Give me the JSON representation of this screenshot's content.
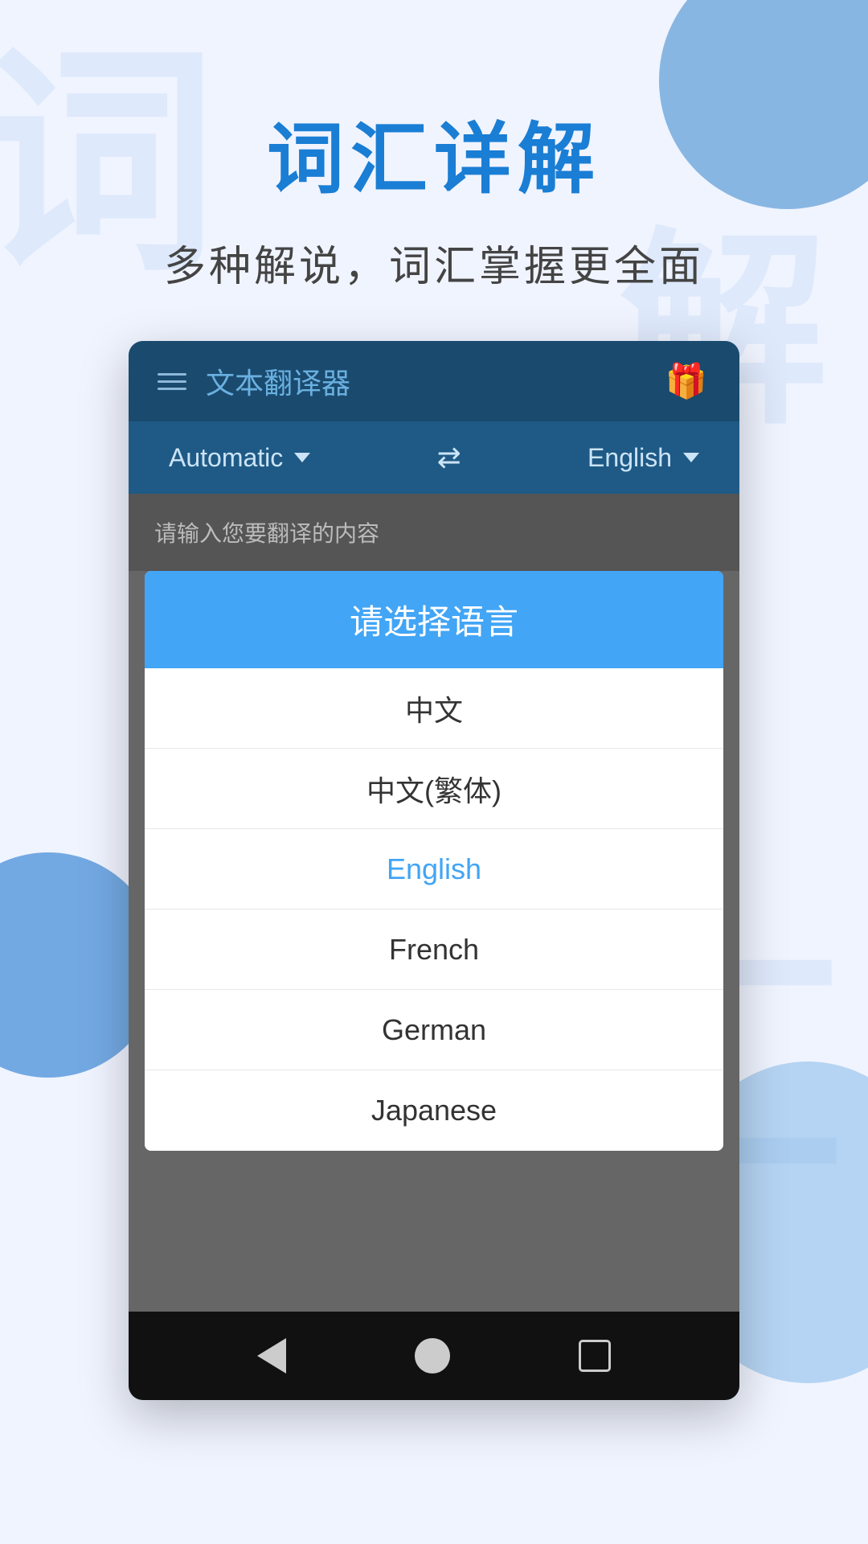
{
  "page": {
    "background_color": "#f0f4ff"
  },
  "hero": {
    "title": "词汇详解",
    "subtitle": "多种解说，词汇掌握更全面"
  },
  "app": {
    "header": {
      "title": "文本翻译器",
      "menu_label": "hamburger-menu",
      "gift_emoji": "🎁"
    },
    "lang_bar": {
      "source_lang": "Automatic",
      "target_lang": "English",
      "swap_symbol": "⇄"
    },
    "input_placeholder": "请输入您要翻译的内容"
  },
  "dialog": {
    "title": "请选择语言",
    "items": [
      {
        "label": "中文",
        "selected": false
      },
      {
        "label": "中文(繁体)",
        "selected": false
      },
      {
        "label": "English",
        "selected": true
      },
      {
        "label": "French",
        "selected": false
      },
      {
        "label": "German",
        "selected": false
      },
      {
        "label": "Japanese",
        "selected": false
      }
    ]
  },
  "bottom_nav": {
    "back_label": "back",
    "home_label": "home",
    "recent_label": "recent"
  },
  "watermarks": {
    "char1": "词",
    "char2": "汇",
    "char3": "解"
  }
}
